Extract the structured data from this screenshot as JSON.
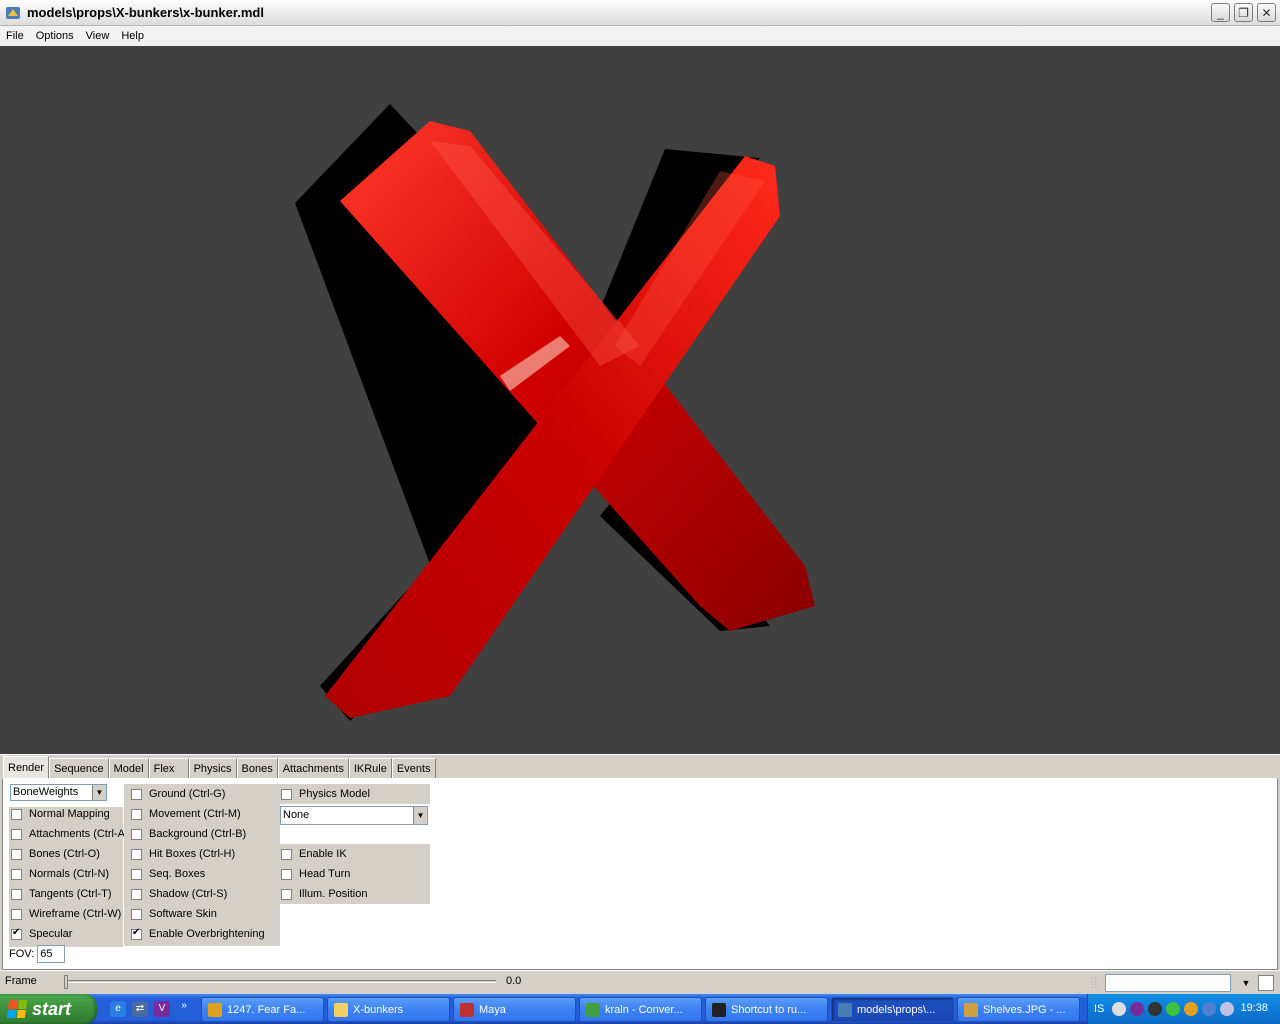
{
  "window": {
    "title": "models\\props\\X-bunkers\\x-bunker.mdl",
    "icon": "model-viewer-icon"
  },
  "menu": [
    "File",
    "Options",
    "View",
    "Help"
  ],
  "colors": {
    "viewport_bg": "#404040",
    "model_red": "#d40000",
    "panel_bg": "#d4d0c8",
    "taskbar_blue": "#245edb"
  },
  "tabs": [
    "Render",
    "Sequence",
    "Model",
    "Flex",
    "Physics",
    "Bones",
    "Attachments",
    "IKRule",
    "Events"
  ],
  "active_tab": "Render",
  "render": {
    "render_mode": "BoneWeights",
    "col1": [
      {
        "label": "Normal Mapping",
        "checked": false
      },
      {
        "label": "Attachments (Ctrl-A)",
        "checked": false
      },
      {
        "label": "Bones (Ctrl-O)",
        "checked": false
      },
      {
        "label": "Normals (Ctrl-N)",
        "checked": false
      },
      {
        "label": "Tangents (Ctrl-T)",
        "checked": false
      },
      {
        "label": "Wireframe (Ctrl-W)",
        "checked": false
      },
      {
        "label": "Specular",
        "checked": true
      }
    ],
    "col2": [
      {
        "label": "Ground (Ctrl-G)",
        "checked": false
      },
      {
        "label": "Movement (Ctrl-M)",
        "checked": false
      },
      {
        "label": "Background (Ctrl-B)",
        "checked": false
      },
      {
        "label": "Hit Boxes (Ctrl-H)",
        "checked": false
      },
      {
        "label": "Seq. Boxes",
        "checked": false
      },
      {
        "label": "Shadow (Ctrl-S)",
        "checked": false
      },
      {
        "label": "Software Skin",
        "checked": false
      },
      {
        "label": "Enable Overbrightening",
        "checked": true
      }
    ],
    "physics_model": {
      "label": "Physics Model",
      "checked": false
    },
    "physics_select": "None",
    "col3": [
      {
        "label": "Enable IK",
        "checked": false
      },
      {
        "label": "Head Turn",
        "checked": false
      },
      {
        "label": "Illum. Position",
        "checked": false
      }
    ],
    "fov_label": "FOV:",
    "fov_value": "65"
  },
  "frame": {
    "label": "Frame",
    "value": "0.0",
    "position": 0
  },
  "taskbar": {
    "start_label": "start",
    "quick_launch": [
      "ie-icon",
      "network-icon",
      "vc-icon"
    ],
    "overflow": "»",
    "buttons": [
      {
        "label": "1247. Fear Fa...",
        "icon": "ftp-icon",
        "active": false
      },
      {
        "label": "X-bunkers",
        "icon": "folder-icon",
        "active": false
      },
      {
        "label": "Maya",
        "icon": "maya-icon",
        "active": false
      },
      {
        "label": "kraln - Conver...",
        "icon": "messenger-icon",
        "active": false
      },
      {
        "label": "Shortcut to ru...",
        "icon": "cmd-icon",
        "active": false
      },
      {
        "label": "models\\props\\...",
        "icon": "model-viewer-icon",
        "active": true
      },
      {
        "label": "Shelves.JPG - ...",
        "icon": "image-viewer-icon",
        "active": false
      }
    ],
    "tray": {
      "lang": "IS",
      "clock": "19:38"
    }
  }
}
